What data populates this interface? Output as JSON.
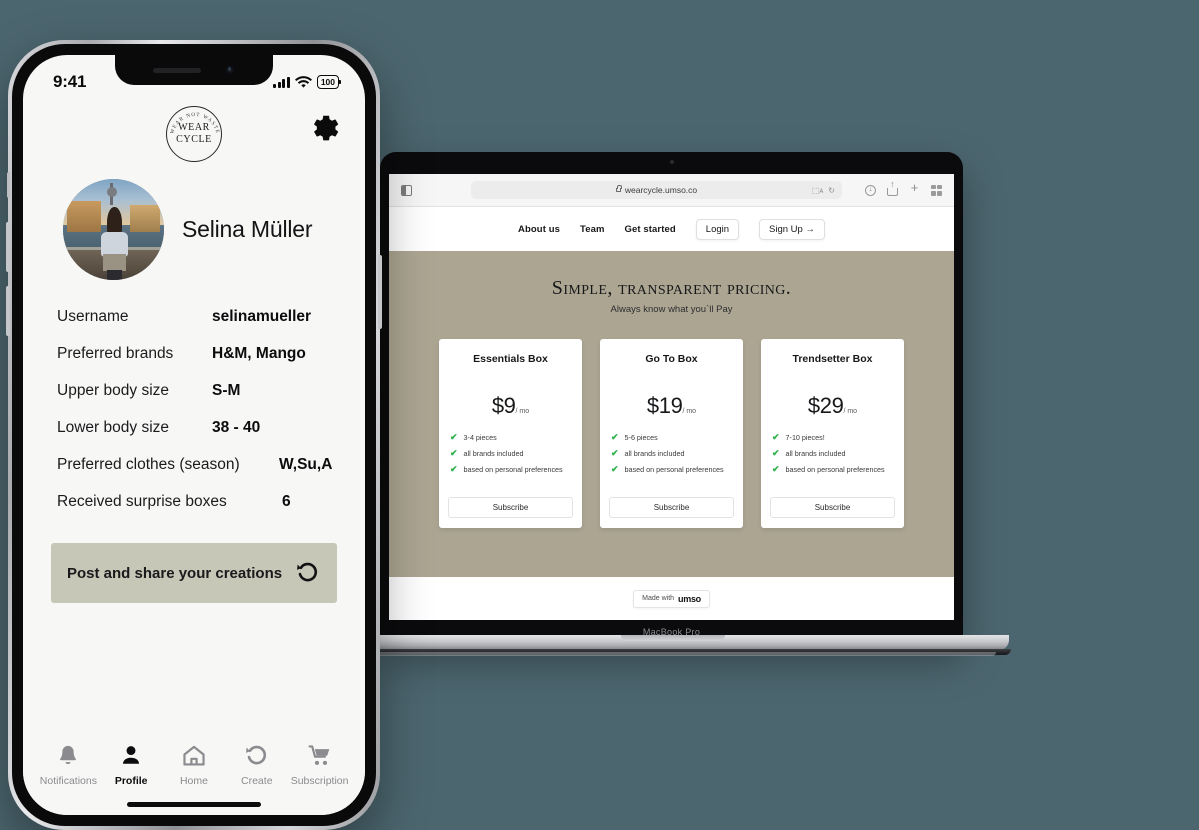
{
  "laptop": {
    "model_label": "MacBook Pro",
    "browser": {
      "url": "wearcycle.umso.co",
      "icons": [
        "sidebar-toggle-icon",
        "lock-icon",
        "reader-icon",
        "reload-icon",
        "download-icon",
        "share-icon",
        "new-tab-icon",
        "tab-overview-icon"
      ]
    },
    "site": {
      "nav_links": [
        "About us",
        "Team",
        "Get started"
      ],
      "login_label": "Login",
      "signup_label": "Sign Up →",
      "pricing": {
        "title": "Simple, transparent pricing.",
        "subtitle": "Always know what you`ll Pay",
        "bg_color": "#aca592",
        "cards": [
          {
            "name": "Essentials Box",
            "price": "$9",
            "period": "/ mo",
            "features": [
              "3-4 pieces",
              "all brands included",
              "based on personal preferences"
            ],
            "button": "Subscribe"
          },
          {
            "name": "Go To Box",
            "price": "$19",
            "period": "/ mo",
            "features": [
              "5-6 pieces",
              "all brands included",
              "based on personal preferences"
            ],
            "button": "Subscribe"
          },
          {
            "name": "Trendsetter Box",
            "price": "$29",
            "period": "/ mo",
            "features": [
              "7-10 pieces!",
              "all brands included",
              "based on personal preferences"
            ],
            "button": "Subscribe"
          }
        ]
      },
      "footer": {
        "made_with": "Made with",
        "brand": "umso"
      }
    }
  },
  "phone": {
    "status": {
      "time": "9:41",
      "battery": "100"
    },
    "logo": {
      "arc": "WEAR NOT WASTE",
      "line1": "WEAR",
      "line2": "CYCLE"
    },
    "profile": {
      "name": "Selina Müller"
    },
    "info_rows": [
      {
        "key": "Username",
        "value": "selinamueller"
      },
      {
        "key": "Preferred brands",
        "value": "H&M, Mango"
      },
      {
        "key": "Upper body size",
        "value": "S-M"
      },
      {
        "key": "Lower body size",
        "value": "38 - 40"
      },
      {
        "key": "Preferred clothes (season)",
        "value": "W,Su,A"
      },
      {
        "key": "Received surprise boxes",
        "value": "6"
      }
    ],
    "cta": {
      "label": "Post and share your creations",
      "icon": "refresh-cycle-icon",
      "bg_color": "#c6c7b7"
    },
    "tabs": [
      {
        "label": "Notifications",
        "icon": "bell-icon",
        "active": false
      },
      {
        "label": "Profile",
        "icon": "person-icon",
        "active": true
      },
      {
        "label": "Home",
        "icon": "home-icon",
        "active": false
      },
      {
        "label": "Create",
        "icon": "refresh-cycle-icon",
        "active": false
      },
      {
        "label": "Subscription",
        "icon": "cart-icon",
        "active": false
      }
    ]
  },
  "page": {
    "background_color": "#4c666f"
  }
}
